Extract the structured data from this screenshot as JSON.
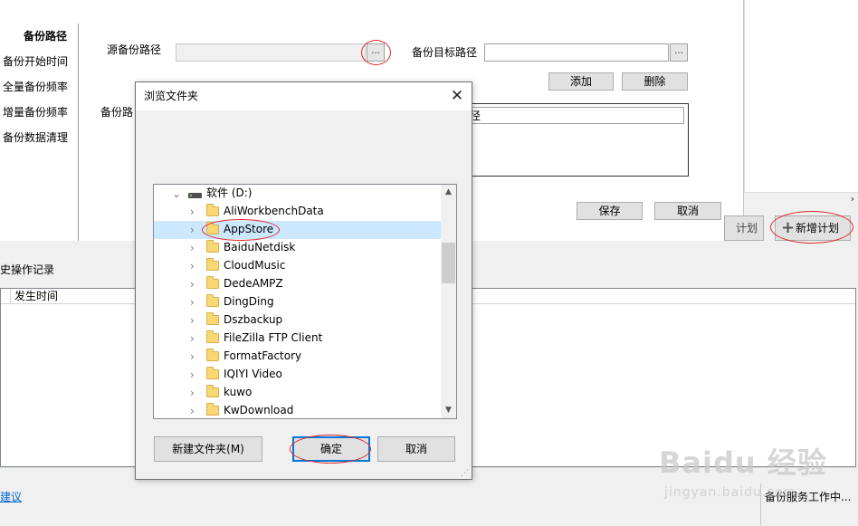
{
  "sidebar": {
    "items": [
      {
        "label": "备份路径"
      },
      {
        "label": "备份开始时间"
      },
      {
        "label": "全量备份频率"
      },
      {
        "label": "增量备份频率"
      },
      {
        "label": "备份数据清理"
      }
    ]
  },
  "form": {
    "source_label": "源备份路径",
    "source_value": "",
    "browse_label": "...",
    "target_label": "备份目标路径",
    "target_value": "",
    "add_label": "添加",
    "delete_label": "删除",
    "list_label_partial": "备份路",
    "list_row_partial": "径",
    "save_label": "保存",
    "cancel_label": "取消"
  },
  "history": {
    "title_partial": "史操作记录",
    "columns": [
      "发生时间"
    ]
  },
  "actions": {
    "partial_button_label": "计划",
    "add_plan_label": "新增计划"
  },
  "status_bar": {
    "link_partial": "建议",
    "status_text": "备份服务工作中..."
  },
  "watermark": {
    "main": "Baidu 经验",
    "sub": "jingyan.baidu.com"
  },
  "dialog": {
    "title": "浏览文件夹",
    "close_glyph": "✕",
    "tree": {
      "drive_label": "软件 (D:)",
      "folders": [
        {
          "name": "AliWorkbenchData",
          "selected": false
        },
        {
          "name": "AppStore",
          "selected": true
        },
        {
          "name": "BaiduNetdisk",
          "selected": false
        },
        {
          "name": "CloudMusic",
          "selected": false
        },
        {
          "name": "DedeAMPZ",
          "selected": false
        },
        {
          "name": "DingDing",
          "selected": false
        },
        {
          "name": "Dszbackup",
          "selected": false
        },
        {
          "name": "FileZilla FTP Client",
          "selected": false
        },
        {
          "name": "FormatFactory",
          "selected": false
        },
        {
          "name": "IQIYI Video",
          "selected": false
        },
        {
          "name": "kuwo",
          "selected": false
        },
        {
          "name": "KwDownload",
          "selected": false
        }
      ]
    },
    "new_folder_label": "新建文件夹(M)",
    "ok_label": "确定",
    "cancel_label": "取消"
  },
  "colors": {
    "highlight_ellipse": "#e0262a",
    "selected_row": "#cce8ff",
    "focus_border": "#0078d7",
    "folder": "#f8d775"
  },
  "icons": {
    "close": "close-icon",
    "expand": "chevron-right-icon",
    "collapse": "chevron-down-icon",
    "drive": "drive-icon",
    "folder": "folder-icon",
    "plus": "plus-icon"
  }
}
